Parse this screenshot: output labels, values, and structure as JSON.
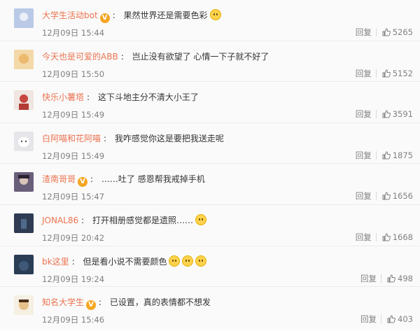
{
  "comments": [
    {
      "name": "大学生活动bot",
      "verified": true,
      "text": "果然世界还是需要色彩",
      "emojis": 1,
      "time": "12月09日 15:44",
      "reply": "回复",
      "likes": "5265",
      "avatar_color": "#b9c9e6"
    },
    {
      "name": "今天也是可爱的ABB",
      "verified": false,
      "text": "岂止没有欲望了 心情一下子就不好了",
      "emojis": 0,
      "time": "12月09日 15:50",
      "reply": "回复",
      "likes": "5152",
      "avatar_color": "#f3d9a8"
    },
    {
      "name": "快乐小薯塔",
      "verified": false,
      "text": "这下斗地主分不清大小王了",
      "emojis": 0,
      "time": "12月09日 15:49",
      "reply": "回复",
      "likes": "3591",
      "avatar_color": "#c7473f"
    },
    {
      "name": "白阿喵和花阿喵",
      "verified": false,
      "text": "我咋感觉你这是要把我送走呢",
      "emojis": 0,
      "time": "12月09日 15:49",
      "reply": "回复",
      "likes": "1875",
      "avatar_color": "#cfcfd4"
    },
    {
      "name": "渣南哥哥",
      "verified": true,
      "text": "……吐了 感恩帮我戒掉手机",
      "emojis": 0,
      "time": "12月09日 15:47",
      "reply": "回复",
      "likes": "1656",
      "avatar_color": "#6a5f7b"
    },
    {
      "name": "JONAL86",
      "verified": false,
      "text": "打开相册感觉都是遗照……",
      "emojis": 1,
      "time": "12月09日 20:42",
      "reply": "回复",
      "likes": "1668",
      "avatar_color": "#2e3b52"
    },
    {
      "name": "bk这里",
      "verified": false,
      "text": "但是看小说不需要颜色",
      "emojis": 3,
      "time": "12月09日 19:24",
      "reply": "回复",
      "likes": "498",
      "avatar_color": "#2b3d55"
    },
    {
      "name": "知名大学生",
      "verified": true,
      "text": "已设置，真的表情都不想发",
      "emojis": 0,
      "time": "12月09日 15:46",
      "reply": "回复",
      "likes": "403",
      "avatar_color": "#e8c08a"
    }
  ],
  "colors": {
    "name": "#eb7350",
    "badge": "#f5a623",
    "meta": "#808080"
  },
  "icons": {
    "like": "thumbs-up-icon",
    "verified": "verified-badge-icon",
    "emoji": "emoji-face-icon"
  }
}
